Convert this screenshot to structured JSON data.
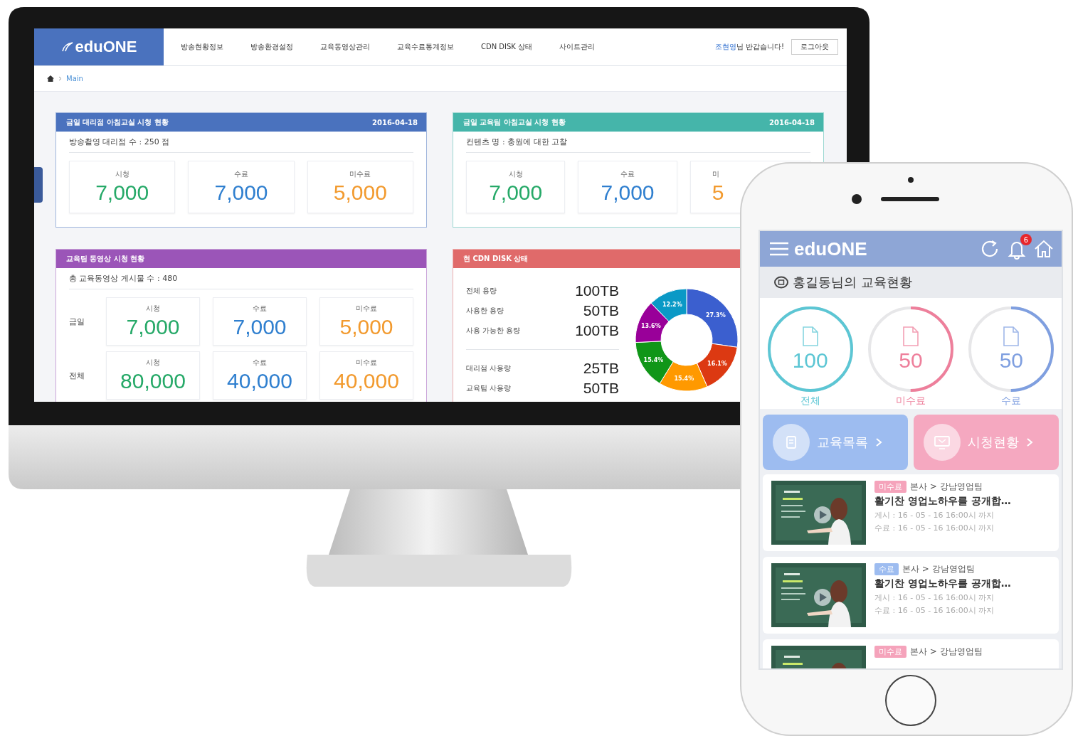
{
  "desktop": {
    "logo": "eduONE",
    "nav": [
      {
        "label": "방송현황정보"
      },
      {
        "label": "방송환경설정"
      },
      {
        "label": "교육동영상관리"
      },
      {
        "label": "교육수료통계정보"
      },
      {
        "label": "CDN DISK 상태"
      },
      {
        "label": "사이트관리"
      }
    ],
    "greeting": {
      "name": "조현영",
      "text": "님 반갑습니다!"
    },
    "logout": "로그아웃",
    "breadcrumb": "Main",
    "cards": [
      {
        "kind": "stats",
        "title": "금일 대리점 아침교실 시청 현황",
        "date": "2016-04-18",
        "color": "#4a72be",
        "summary": "방송촬영 대리점 수 : 250 점",
        "rows": [
          {
            "stats": [
              {
                "kind": "view",
                "label": "시청",
                "value": "7,000"
              },
              {
                "kind": "done",
                "label": "수료",
                "value": "7,000"
              },
              {
                "kind": "undone",
                "label": "미수료",
                "value": "5,000"
              }
            ]
          }
        ]
      },
      {
        "kind": "stats",
        "title": "금일 교육팀 아침교실 시청 현황",
        "date": "2016-04-18",
        "color": "#45b5aa",
        "summary": "컨텐츠 명 : 충원에 대한 고찰",
        "rows": [
          {
            "stats": [
              {
                "kind": "view",
                "label": "시청",
                "value": "7,000"
              },
              {
                "kind": "done",
                "label": "수료",
                "value": "7,000"
              },
              {
                "kind": "undone",
                "label": "미",
                "value": "5",
                "clipped": true
              }
            ]
          }
        ]
      },
      {
        "kind": "stats",
        "title": "교육팀 동영상 시청 현황",
        "color": "#9b55b8",
        "summary": "총 교육동영상 게시물 수 : 480",
        "rows": [
          {
            "label": "금일",
            "stats": [
              {
                "kind": "view",
                "label": "시청",
                "value": "7,000"
              },
              {
                "kind": "done",
                "label": "수료",
                "value": "7,000"
              },
              {
                "kind": "undone",
                "label": "미수료",
                "value": "5,000"
              }
            ]
          },
          {
            "label": "전체",
            "stats": [
              {
                "kind": "view",
                "label": "시청",
                "value": "80,000"
              },
              {
                "kind": "done",
                "label": "수료",
                "value": "40,000"
              },
              {
                "kind": "undone",
                "label": "미수료",
                "value": "40,000"
              }
            ]
          }
        ]
      },
      {
        "kind": "disk",
        "title": "현 CDN DISK 상태",
        "color": "#e06a6a",
        "groups": [
          [
            {
              "label": "전체 용량",
              "value": "100TB"
            },
            {
              "label": "사용한 용량",
              "value": "50TB"
            },
            {
              "label": "사용 가능한 용량",
              "value": "100TB"
            }
          ],
          [
            {
              "label": "대리점 사용량",
              "value": "25TB"
            },
            {
              "label": "교육팀 사용량",
              "value": "50TB"
            }
          ]
        ],
        "chart_data": {
          "type": "donut",
          "values": [
            27.3,
            16.1,
            15.4,
            15.4,
            13.6,
            12.2
          ],
          "value_labels": [
            "27.3%",
            "16.1%",
            "15.4%",
            "15.4%",
            "13.6%",
            "12.2%"
          ]
        }
      }
    ]
  },
  "mobile": {
    "logo": "eduONE",
    "notification_count": "6",
    "section_title": "홍길동님의 교육현황",
    "summary": [
      {
        "value": "100",
        "label": "전체",
        "color": "#5cc6d4",
        "level": 1
      },
      {
        "value": "50",
        "label": "미수료",
        "color": "#ee7f9b",
        "level": 0.5
      },
      {
        "value": "50",
        "label": "수료",
        "color": "#7f9fe0",
        "level": 0.5
      }
    ],
    "shortcuts": [
      {
        "label": "교육목록",
        "color": "#9dbcf0"
      },
      {
        "label": "시청현황",
        "color": "#f5a8c0"
      }
    ],
    "courses": [
      {
        "status": "미수료",
        "color": "#f5a3bb",
        "path": "본사 > 강남영업팀",
        "title": "활기찬 영업노하우를 공개합…",
        "posted": "게시 : 16 - 05 - 16 16:00시 까지",
        "completion": "수료 : 16 - 05 - 16 16:00시 까지"
      },
      {
        "status": "수료",
        "color": "#9dbcf0",
        "path": "본사 > 강남영업팀",
        "title": "활기찬 영업노하우를 공개합…",
        "posted": "게시 : 16 - 05 - 16 16:00시 까지",
        "completion": "수료 : 16 - 05 - 16 16:00시 까지"
      },
      {
        "status": "미수료",
        "color": "#f5a3bb",
        "path": "본사 > 강남영업팀"
      }
    ]
  }
}
